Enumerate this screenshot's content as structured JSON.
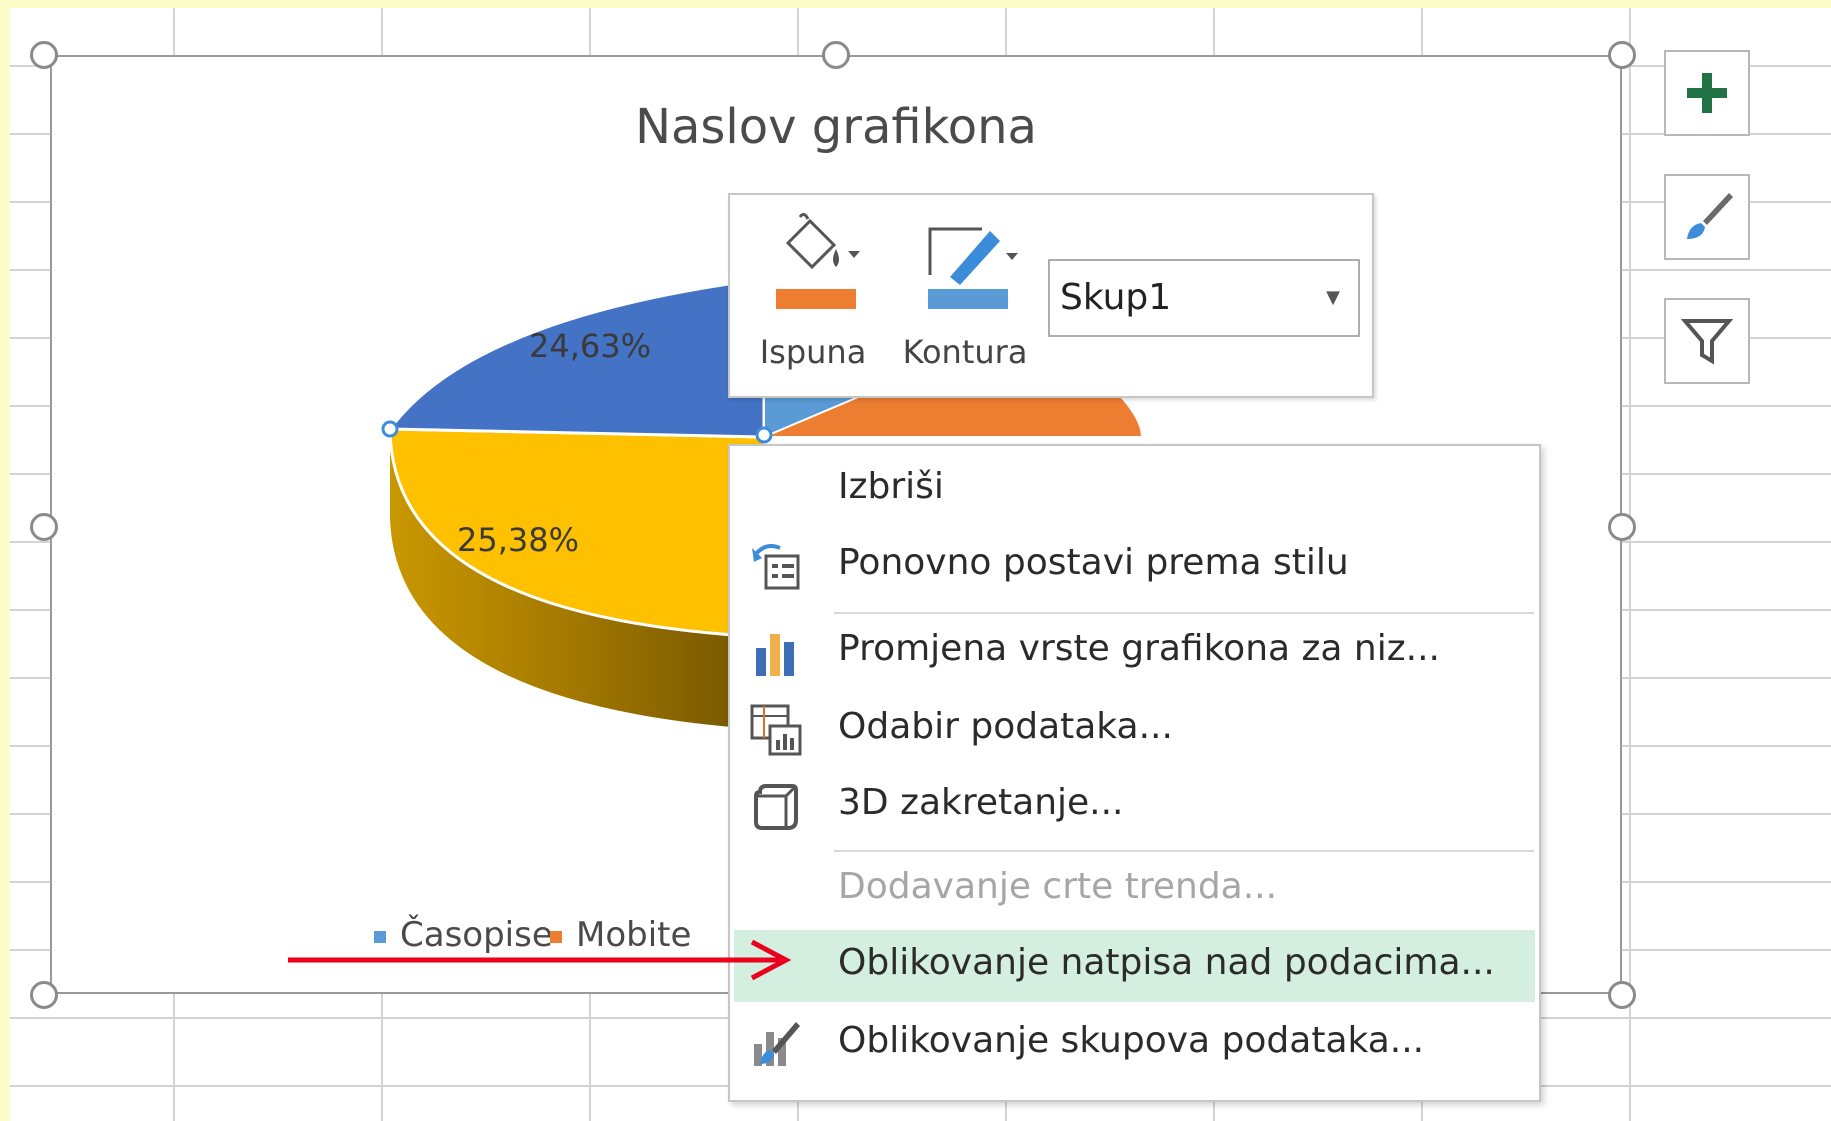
{
  "chart": {
    "title": "Naslov grafikona",
    "slice_labels": [
      "24,63%",
      "25,38%"
    ],
    "legend": [
      {
        "label": "Časopise",
        "color": "#5b9bd5"
      },
      {
        "label": "Mobite",
        "color": "#ed7d31"
      }
    ]
  },
  "chart_data": {
    "type": "pie",
    "title": "Naslov grafikona",
    "categories": [
      "Časopise",
      "Mobite"
    ],
    "values": [
      25.38,
      24.63
    ],
    "data_labels": [
      "25,38%",
      "24,63%"
    ],
    "note_visible": "Only two of the slice labels are visible; the remaining slices are covered by the menu",
    "colors": {
      "blue": "#4472c4",
      "orange": "#ed7d31",
      "yellow": "#ffc000",
      "light_blue": "#5b9bd5"
    }
  },
  "mini_toolbar": {
    "fill_label": "Ispuna",
    "outline_label": "Kontura",
    "series_value": "Skup1",
    "fill_color": "#ed7d31",
    "outline_color": "#5b9bd5"
  },
  "context_menu": {
    "items": [
      {
        "label": "Izbriši",
        "icon": "none",
        "enabled": true
      },
      {
        "label": "Ponovno postavi prema stilu",
        "icon": "reset-style-icon",
        "enabled": true
      },
      {
        "label": "Promjena vrste grafikona za niz...",
        "icon": "bar-chart-icon",
        "enabled": true
      },
      {
        "label": "Odabir podataka...",
        "icon": "select-data-icon",
        "enabled": true
      },
      {
        "label": "3D zakretanje...",
        "icon": "cube-icon",
        "enabled": true
      },
      {
        "label": "Dodavanje crte trenda...",
        "icon": "none",
        "enabled": false
      },
      {
        "label": "Oblikovanje natpisa nad podacima...",
        "icon": "none",
        "enabled": true,
        "highlighted": true
      },
      {
        "label": "Oblikovanje skupova podataka...",
        "icon": "format-series-icon",
        "enabled": true
      }
    ]
  },
  "side_buttons": [
    "chart-elements-icon",
    "chart-styles-icon",
    "chart-filter-icon"
  ],
  "accent": {
    "arrow": "#e8001c",
    "highlight": "#d4eedf",
    "plus": "#217346"
  }
}
